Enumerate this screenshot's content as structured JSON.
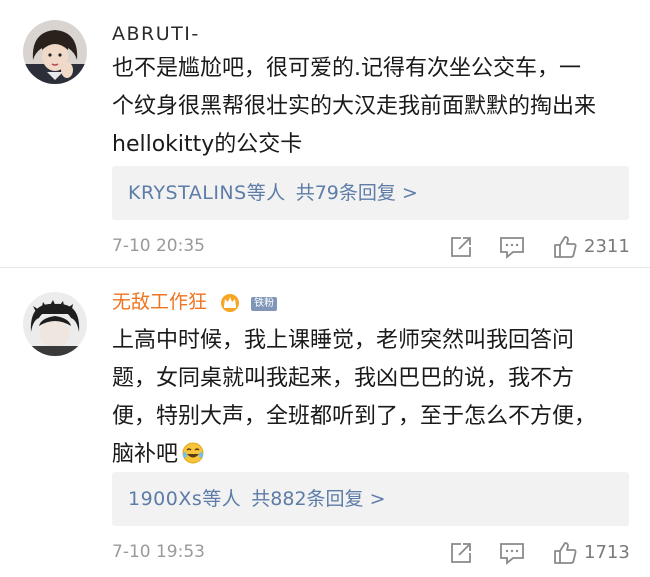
{
  "comments": [
    {
      "username": "ABRUTI-",
      "body_lines": [
        "也不是尴尬吧，很可爱的.记得有次坐公交车，一",
        "个纹身很黑帮很壮实的大汉走我前面默默的掏出来",
        "hellokitty的公交卡"
      ],
      "replies": {
        "users": "KRYSTALINS等人",
        "count": "共79条回复 >"
      },
      "timestamp": "7-10 20:35",
      "likes": "2311"
    },
    {
      "username": "无敌工作狂",
      "badge": "铁粉",
      "body_lines": [
        "上高中时候，我上课睡觉，老师突然叫我回答问",
        "题，女同桌就叫我起来，我凶巴巴的说，我不方",
        "便，特别大声，全班都听到了，至于怎么不方便，",
        "脑补吧"
      ],
      "replies": {
        "users": "1900Xs等人",
        "count": "共882条回复 >"
      },
      "timestamp": "7-10 19:53",
      "likes": "1713"
    }
  ],
  "colors": {
    "username_default": "#2b2b2b",
    "username_vip": "#f0731e",
    "link_blue": "#5d7ca8",
    "meta_gray": "#9a9a9a",
    "reply_box_bg": "#f2f2f2",
    "fan_badge_bg": "#7f96b8"
  },
  "icons": [
    "share-icon",
    "comment-icon",
    "thumbs-up-icon",
    "crown-icon",
    "laughing-tears-emoji"
  ]
}
